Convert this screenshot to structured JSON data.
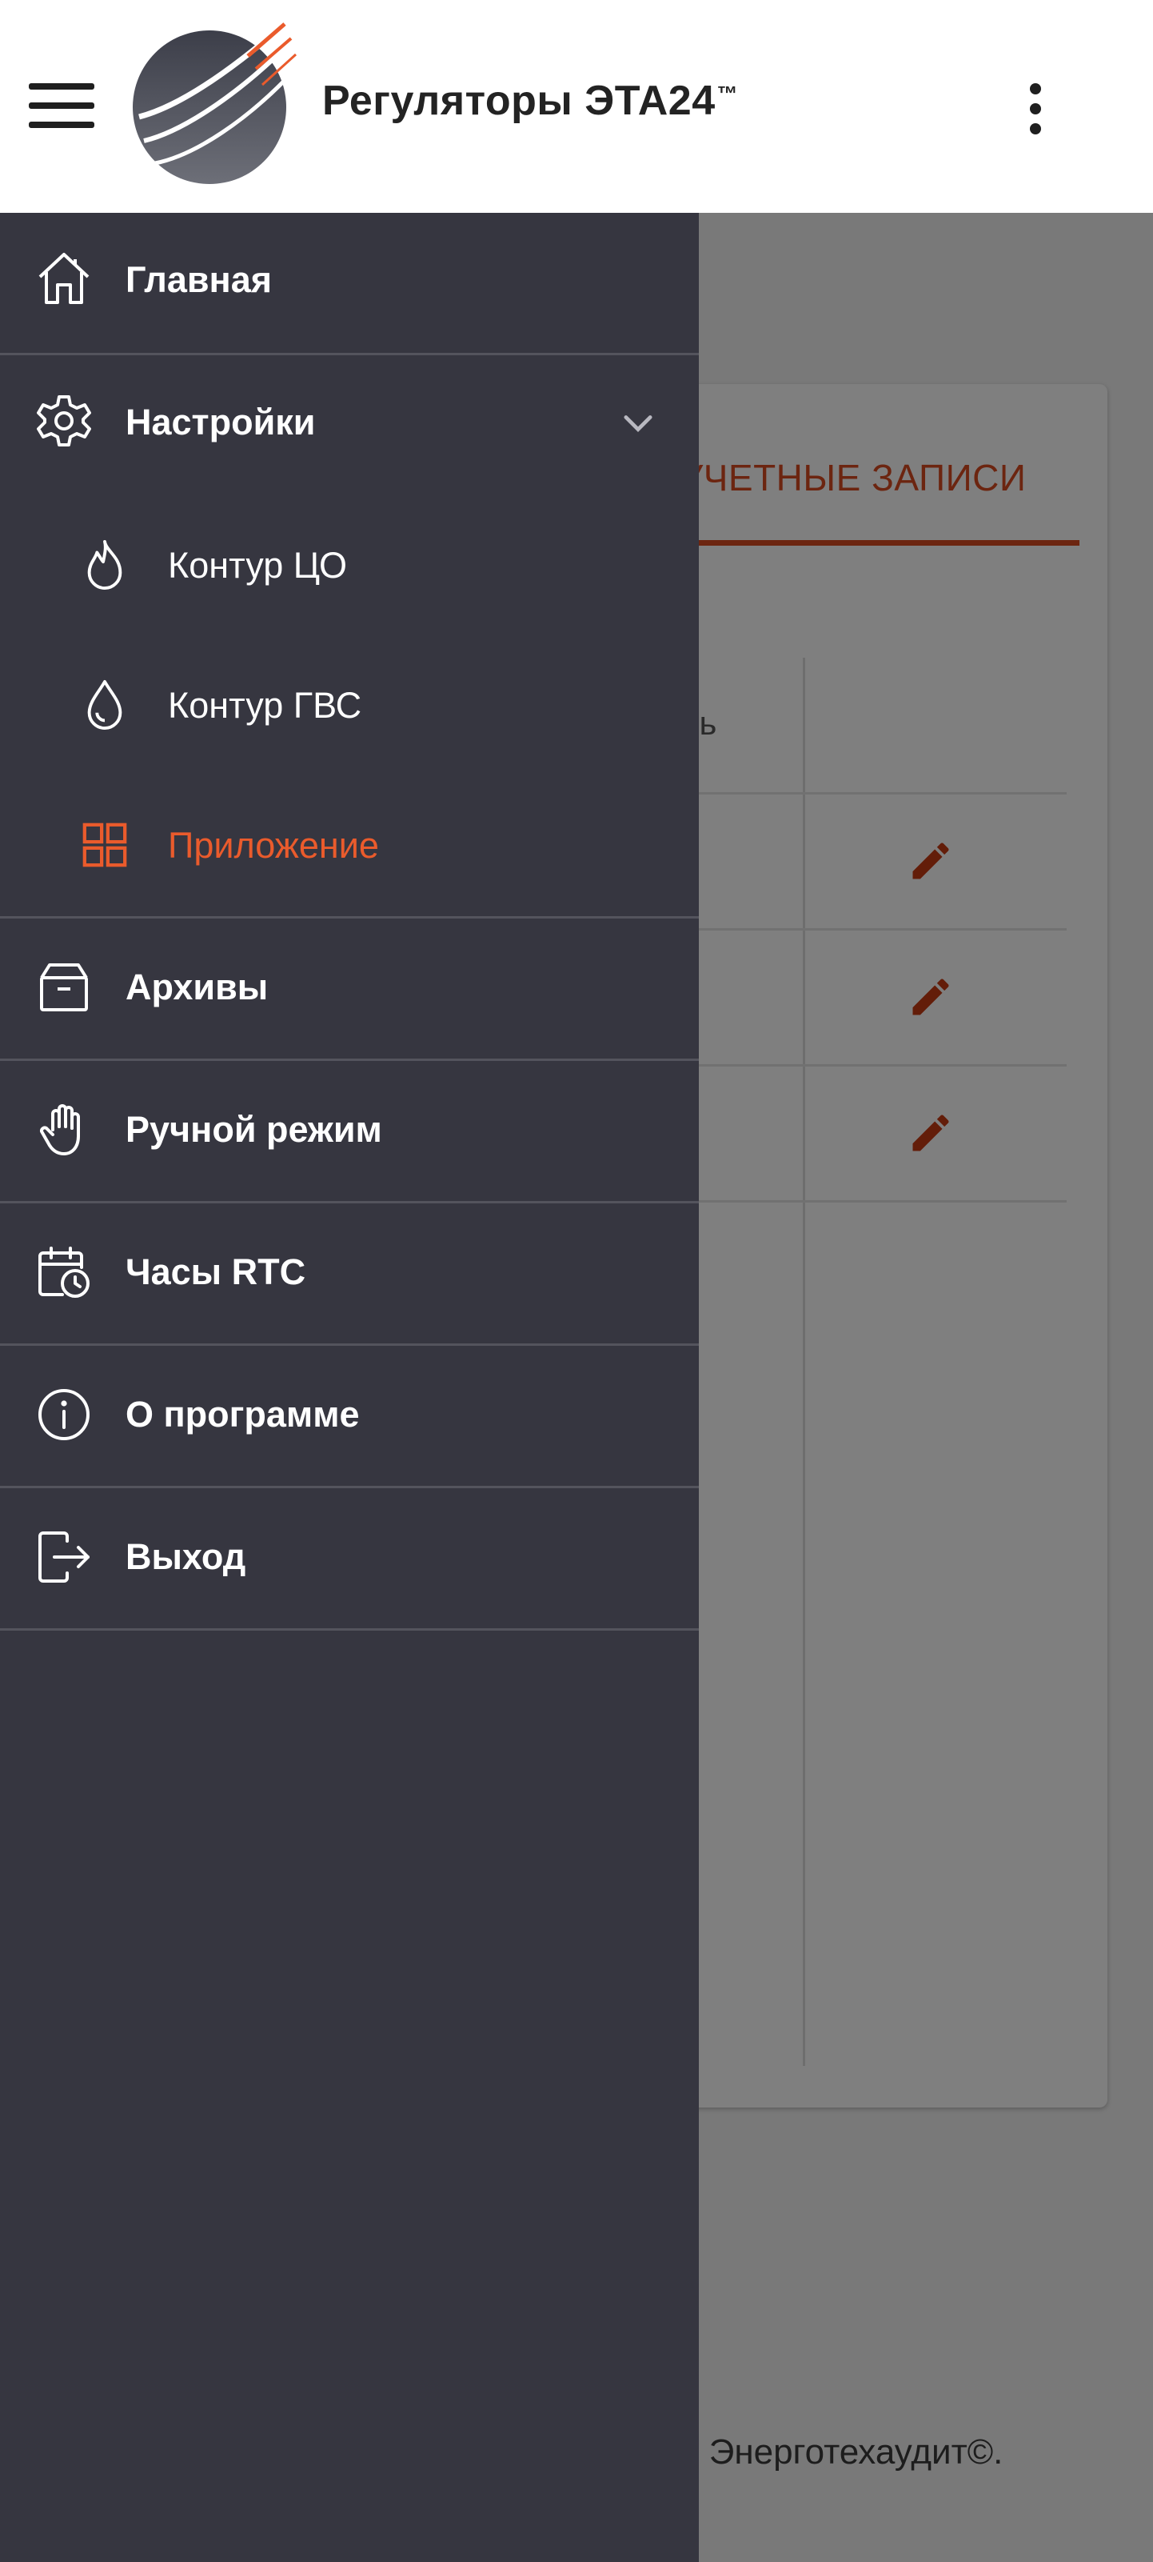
{
  "app": {
    "title": "Регуляторы ЭТА24",
    "title_mark": "™"
  },
  "background": {
    "tab_label": "УЧЕТНЫЕ ЗАПИСИ",
    "column_header": "ль",
    "footer": "р Энерготехаудит©."
  },
  "drawer": {
    "home": "Главная",
    "settings": "Настройки",
    "settings_items": [
      {
        "label": "Контур ЦО",
        "icon": "flame-icon"
      },
      {
        "label": "Контур ГВС",
        "icon": "water-drop-icon"
      },
      {
        "label": "Приложение",
        "icon": "app-grid-icon",
        "active": true
      }
    ],
    "archives": "Архивы",
    "manual": "Ручной режим",
    "rtc": "Часы RTC",
    "about": "О программе",
    "logout": "Выход"
  },
  "colors": {
    "drawer_bg": "#363640",
    "accent": "#ea5b2c",
    "edit_icon": "#c73a12"
  }
}
